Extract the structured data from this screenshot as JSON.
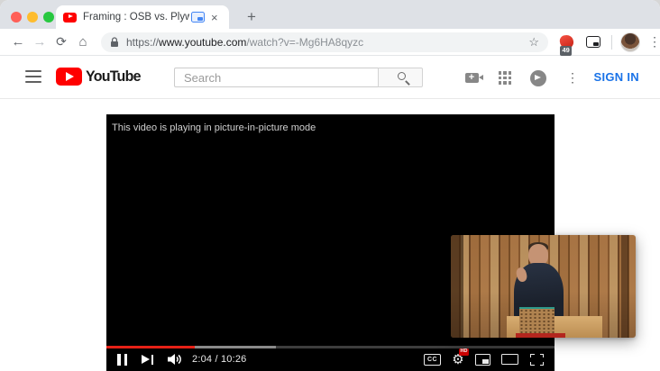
{
  "glyphs": {
    "close": "×",
    "plus": "+",
    "back": "←",
    "forward": "→",
    "reload": "⟳",
    "home": "⌂",
    "bookmark_star": "☆",
    "menu_kebab": "⋮",
    "settings_gear": "⚙"
  },
  "browser": {
    "tab": {
      "title": "Framing : OSB vs. Plywood"
    },
    "omnibox": {
      "scheme": "https://",
      "domain": "www.youtube.com",
      "path": "/watch?v=-Mg6HA8qyzc"
    },
    "extensions": {
      "badge_count": "49"
    }
  },
  "youtube": {
    "logo_text": "YouTube",
    "search_placeholder": "Search",
    "sign_in_label": "SIGN IN"
  },
  "player": {
    "pip_message": "This video is playing in picture-in-picture mode",
    "time_display": "2:04 / 10:26",
    "current_time": "2:04",
    "duration": "10:26",
    "progress_percent": 19.8,
    "buffer_percent": 37.8,
    "cc_label": "CC",
    "hd_badge": "HD"
  },
  "colors": {
    "youtube_red": "#ff0000",
    "progress_red": "#e62117",
    "signin_blue": "#1a73e8",
    "tabstrip_gray": "#dee1e6",
    "hd_badge_red": "#cc0000"
  }
}
